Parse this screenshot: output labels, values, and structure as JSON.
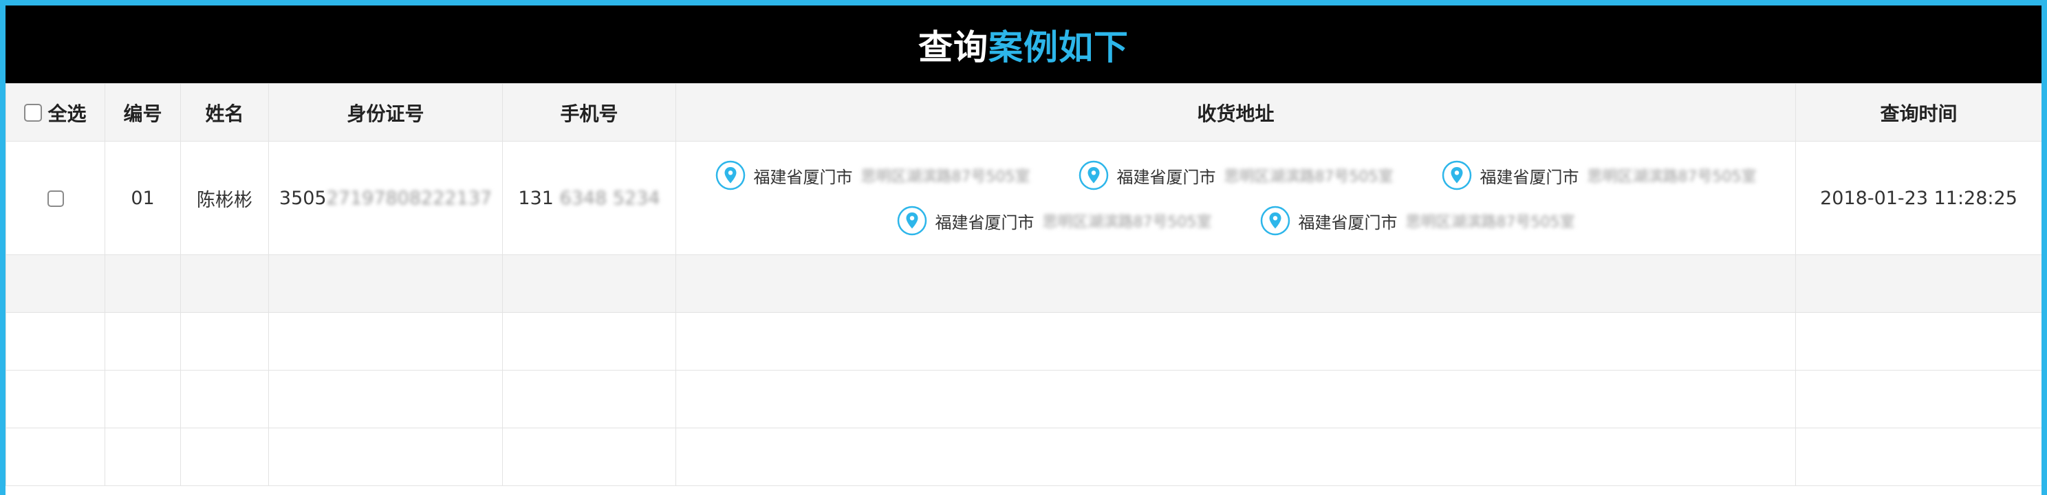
{
  "title": {
    "part1": "查询",
    "part2": "案例如下"
  },
  "table": {
    "headers": {
      "select_all": "全选",
      "number": "编号",
      "name": "姓名",
      "id_card": "身份证号",
      "phone": "手机号",
      "address": "收货地址",
      "query_time": "查询时间"
    },
    "rows": [
      {
        "number": "01",
        "name": "陈彬彬",
        "id_prefix": "3505",
        "id_masked": "27197808222137",
        "phone_prefix": "131",
        "phone_masked": "6348 5234",
        "query_time": "2018-01-23 11:28:25",
        "addresses": [
          {
            "prefix": "福建省厦门市",
            "masked": "思明区湖滨路87号505室"
          },
          {
            "prefix": "福建省厦门市",
            "masked": "思明区湖滨路87号505室"
          },
          {
            "prefix": "福建省厦门市",
            "masked": "思明区湖滨路87号505室"
          },
          {
            "prefix": "福建省厦门市",
            "masked": "思明区湖滨路87号505室"
          },
          {
            "prefix": "福建省厦门市",
            "masked": "思明区湖滨路87号505室"
          }
        ]
      }
    ]
  },
  "colors": {
    "accent": "#2db6ea",
    "header_bg": "#000000",
    "table_header_bg": "#f4f4f4"
  },
  "icons": {
    "address": "location-pin-icon"
  }
}
